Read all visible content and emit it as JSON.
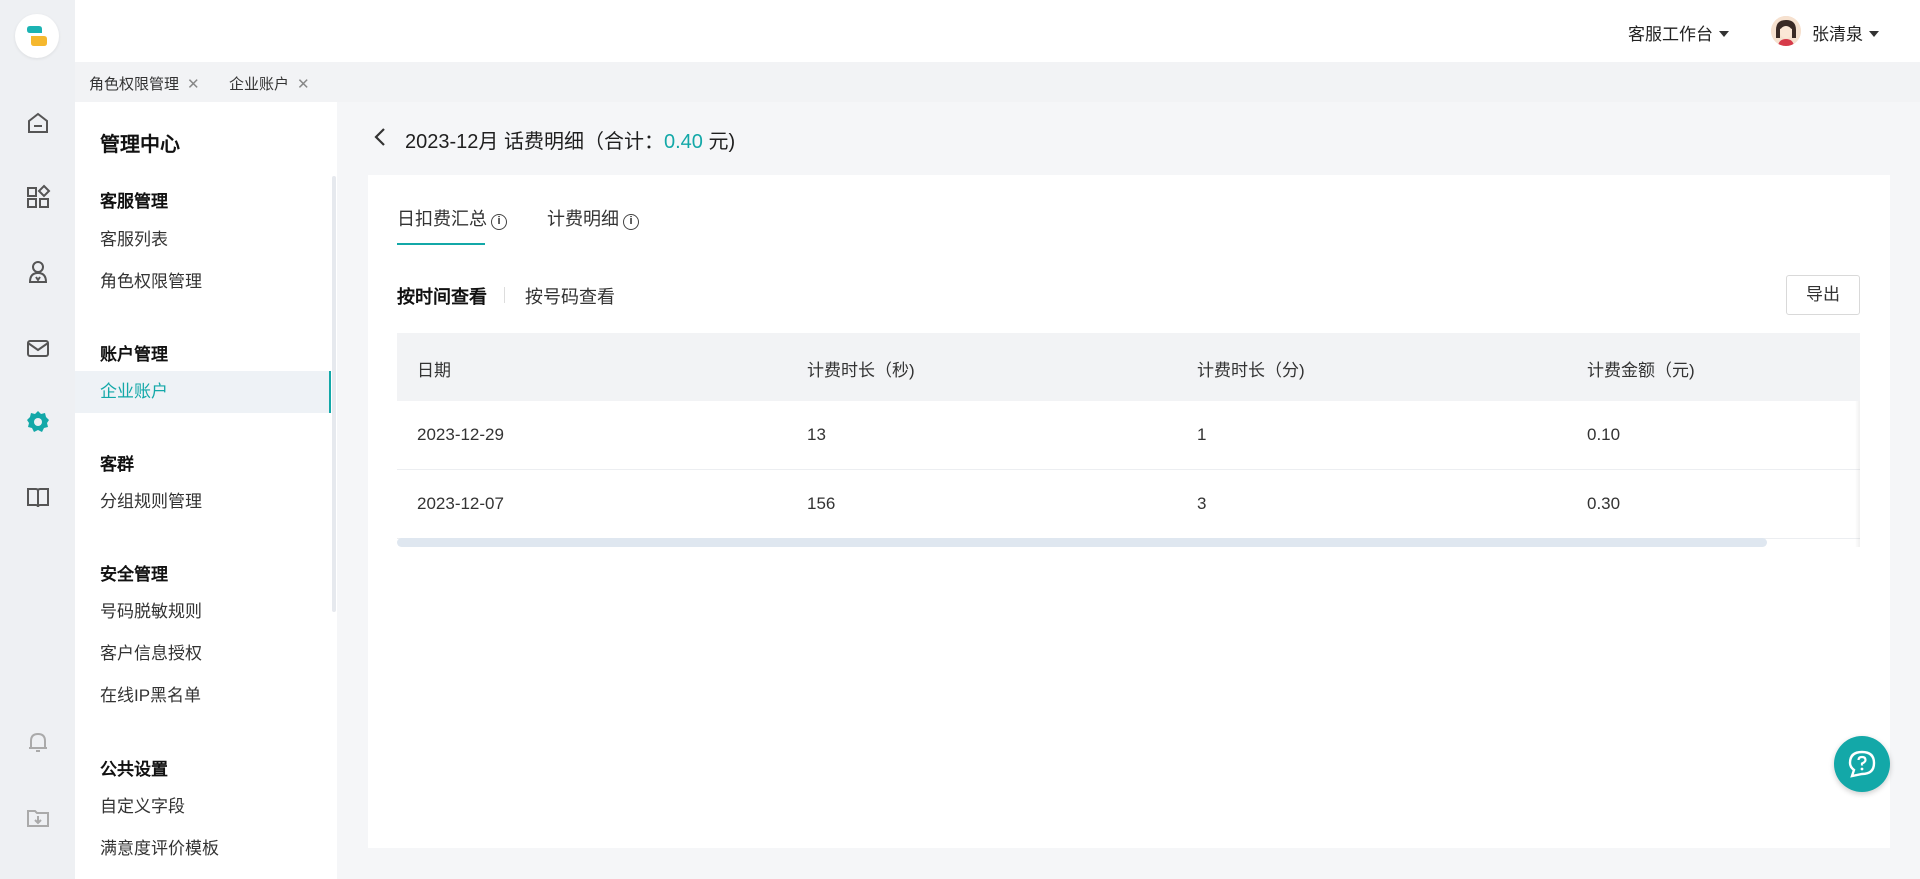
{
  "topbar": {
    "workbench_label": "客服工作台",
    "username": "张清泉"
  },
  "tabs": [
    {
      "label": "角色权限管理"
    },
    {
      "label": "企业账户"
    }
  ],
  "sidebar": {
    "title": "管理中心",
    "groups": [
      {
        "label": "客服管理",
        "items": [
          "客服列表",
          "角色权限管理"
        ]
      },
      {
        "label": "账户管理",
        "items": [
          "企业账户"
        ]
      },
      {
        "label": "客群",
        "items": [
          "分组规则管理"
        ]
      },
      {
        "label": "安全管理",
        "items": [
          "号码脱敏规则",
          "客户信息授权",
          "在线IP黑名单"
        ]
      },
      {
        "label": "公共设置",
        "items": [
          "自定义字段",
          "满意度评价模板"
        ]
      }
    ],
    "active_item": "企业账户"
  },
  "page": {
    "title_prefix": "2023-12月 话费明细（合计：",
    "total_amount": "0.40",
    "title_suffix": " 元)"
  },
  "content_tabs": [
    {
      "label": "日扣费汇总"
    },
    {
      "label": "计费明细"
    }
  ],
  "view_toggle": {
    "by_time": "按时间查看",
    "by_number": "按号码查看"
  },
  "export_label": "导出",
  "table": {
    "headers": [
      "日期",
      "计费时长（秒)",
      "计费时长（分)",
      "计费金额（元)"
    ],
    "rows": [
      [
        "2023-12-29",
        "13",
        "1",
        "0.10"
      ],
      [
        "2023-12-07",
        "156",
        "3",
        "0.30"
      ]
    ]
  },
  "colors": {
    "accent": "#13a8a8",
    "rail_bg": "#eef0f3",
    "page_bg": "#f5f6f8"
  },
  "icons": {
    "rail": [
      "app-logo-icon",
      "home-icon",
      "apps-icon",
      "customer-service-icon",
      "mail-icon",
      "settings-icon",
      "book-icon",
      "bell-icon",
      "download-folder-icon"
    ],
    "help": "chat-help-icon"
  }
}
